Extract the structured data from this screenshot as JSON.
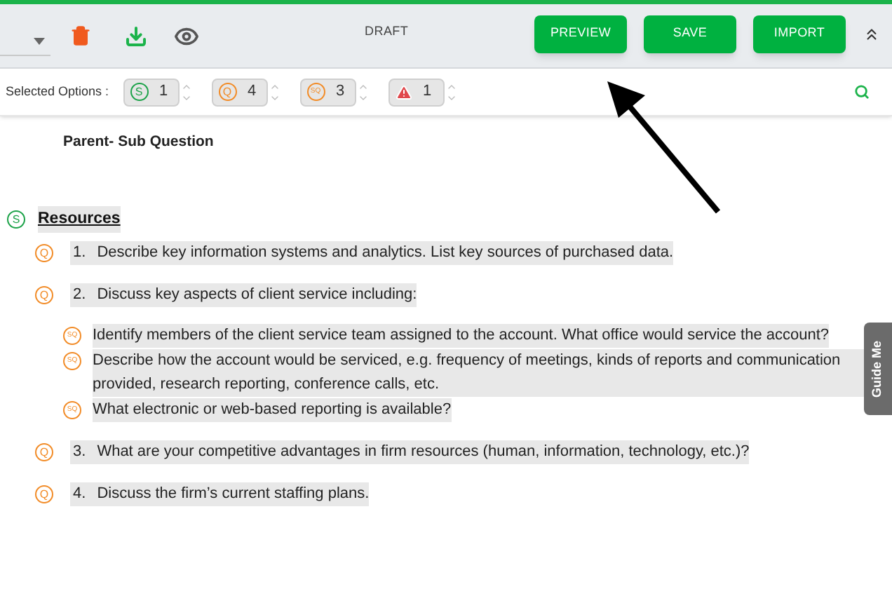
{
  "toolbar": {
    "status": "DRAFT",
    "buttons": [
      "PREVIEW",
      "SAVE",
      "IMPORT"
    ]
  },
  "selected_options": {
    "label": "Selected Options :",
    "counters": [
      {
        "kind": "section",
        "icon_text": "S",
        "value": "1"
      },
      {
        "kind": "question",
        "icon_text": "Q",
        "value": "4"
      },
      {
        "kind": "subquestion",
        "icon_text": "SQ",
        "value": "3"
      },
      {
        "kind": "warning",
        "value": "1"
      }
    ]
  },
  "column_heading": "Parent- Sub Question",
  "sections": [
    {
      "icon_text": "S",
      "title": "Resources",
      "children": [
        {
          "icon_text": "Q",
          "number": "1.",
          "text": "Describe key information systems and analytics. List key sources of purchased data."
        },
        {
          "icon_text": "Q",
          "number": "2.",
          "text": "Discuss key aspects of client service including:",
          "children": [
            {
              "icon_text": "SQ",
              "text": "Identify members of the client service team assigned to the account. What office would service the account?"
            },
            {
              "icon_text": "SQ",
              "text": "Describe how the account would be serviced, e.g. frequency of meetings, kinds of reports and communication provided, research reporting, conference calls, etc."
            },
            {
              "icon_text": "SQ",
              "text": "What electronic or web-based reporting is available?"
            }
          ]
        },
        {
          "icon_text": "Q",
          "number": "3.",
          "text": "What are your competitive advantages in firm resources (human, information, technology, etc.)?"
        },
        {
          "icon_text": "Q",
          "number": "4.",
          "text": "Discuss the firm’s current staffing plans."
        }
      ]
    }
  ],
  "guide_tab": "Guide Me"
}
